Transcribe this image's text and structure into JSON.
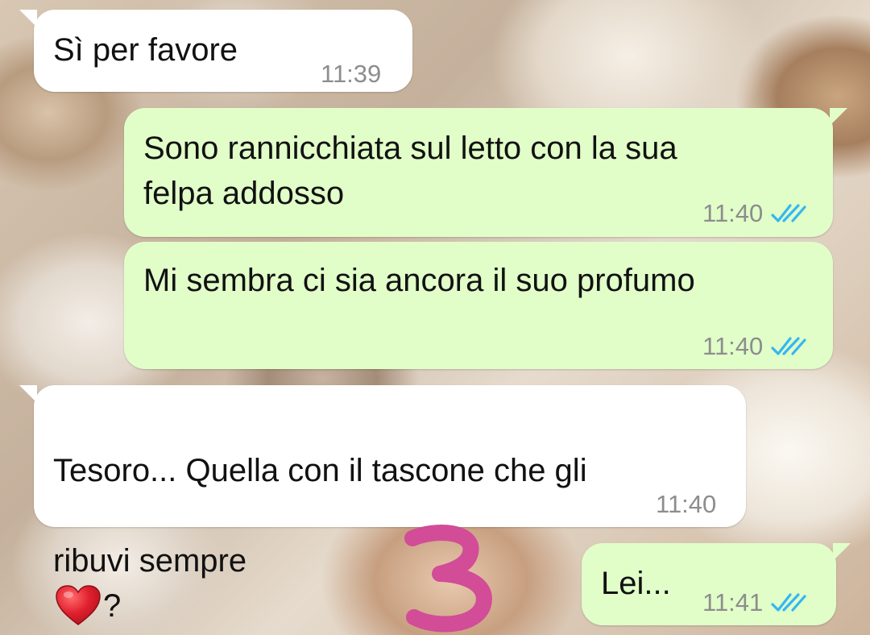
{
  "chat": {
    "messages": [
      {
        "direction": "in",
        "text": "Sì per favore",
        "time": "11:39",
        "read": false
      },
      {
        "direction": "out",
        "text": "Sono rannicchiata sul letto con la sua\nfelpa addosso",
        "time": "11:40",
        "read": true
      },
      {
        "direction": "out",
        "text": "Mi sembra ci sia ancora il suo profumo",
        "time": "11:40",
        "read": true
      },
      {
        "direction": "in",
        "text_line1": "Tesoro... Quella con il tascone che gli",
        "text_line2_before": "ribuvi sempre",
        "emoji": "red-heart",
        "text_line2_after": "?",
        "time": "11:40",
        "read": false
      },
      {
        "direction": "out",
        "text": "Lei...",
        "time": "11:41",
        "read": true
      }
    ]
  },
  "annotation": {
    "text": "3",
    "color": "#d24c97"
  },
  "colors": {
    "incoming_bubble": "#ffffff",
    "outgoing_bubble": "#e1fec9",
    "read_ticks": "#34b7f1",
    "timestamp": "#8d8d8d",
    "heart": "#e0202e"
  }
}
